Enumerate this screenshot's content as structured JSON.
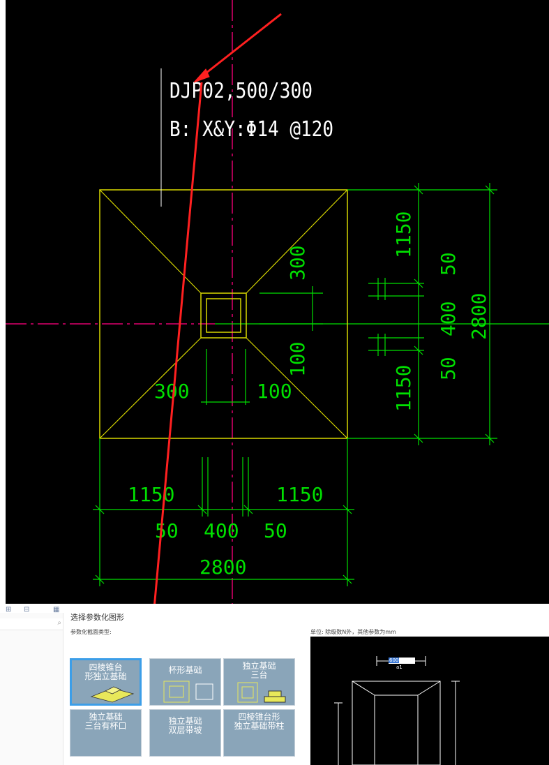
{
  "cad": {
    "label_line1": "DJP02,500/300",
    "label_line2": "B: X&Y:Φ14 @120",
    "dims": {
      "right_top": "1150",
      "right_bottom": "1150",
      "right_50_top": "50",
      "right_400": "400",
      "right_50_bottom": "50",
      "right_total": "2800",
      "inner_300_top": "300",
      "inner_100_right": "100",
      "inner_300_left": "300",
      "inner_100_bottom": "100",
      "bottom_1150_left": "1150",
      "bottom_1150_right": "1150",
      "bottom_50_left": "50",
      "bottom_400": "400",
      "bottom_50_right": "50",
      "bottom_total": "2800"
    },
    "colors": {
      "outline": "#d7d700",
      "dimension": "#00e000",
      "axis": "#e0006e",
      "text": "#ffffff",
      "arrow": "#ff2020"
    }
  },
  "dialog": {
    "title": "选择参数化图形",
    "type_label": "参数化截面类型:",
    "unit_label": "单位:  除级数N外，其他参数为mm",
    "tiles": [
      {
        "label": "四棱锥台\n形独立基础",
        "selected": true
      },
      {
        "label": "杯形基础",
        "selected": false
      },
      {
        "label": "独立基础\n三台",
        "selected": false
      },
      {
        "label": "独立基础\n三台有杯口",
        "selected": false
      },
      {
        "label": "独立基础\n双层带坡",
        "selected": false
      },
      {
        "label": "四棱锥台形\n独立基础带柱",
        "selected": false
      }
    ],
    "preview": {
      "param_value": "600",
      "param_label": "a1"
    }
  }
}
